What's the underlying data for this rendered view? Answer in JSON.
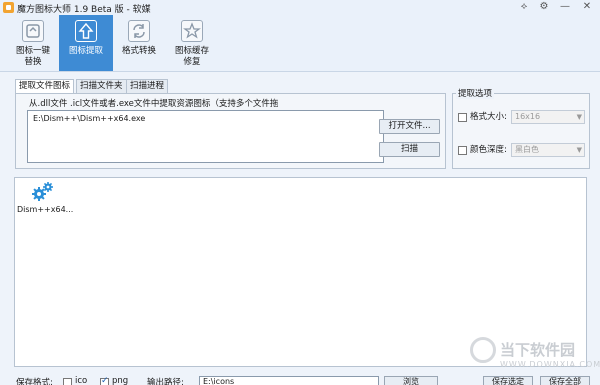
{
  "window": {
    "title": "魔方图标大师 1.9 Beta 版 - 软媒",
    "controls": {
      "skin": "⟡",
      "settings": "⚙",
      "minimize": "—",
      "close": "✕"
    }
  },
  "toolbar": {
    "items": [
      {
        "label": "图标一键\n替换",
        "icon": "replace-icon",
        "active": false
      },
      {
        "label": "图标提取",
        "icon": "extract-arrow-icon",
        "active": true
      },
      {
        "label": "格式转换",
        "icon": "convert-icon",
        "active": false
      },
      {
        "label": "图标缓存\n修复",
        "icon": "cache-repair-icon",
        "active": false
      }
    ]
  },
  "tabs": [
    {
      "label": "提取文件图标",
      "active": true
    },
    {
      "label": "扫描文件夹",
      "active": false
    },
    {
      "label": "扫描进程",
      "active": false
    }
  ],
  "extract": {
    "hint": "从.dll文件 .icl文件或者.exe文件中提取资源图标（支持多个文件拖",
    "path_value": "E:\\Dism++\\Dism++x64.exe",
    "open_button": "打开文件...",
    "scan_button": "扫描"
  },
  "options": {
    "title": "提取选项",
    "size_label": "格式大小:",
    "size_value": "16x16",
    "depth_label": "颜色深度:",
    "depth_value": "黑白色"
  },
  "results": {
    "items": [
      {
        "label": "Dism++x64...",
        "icon": "gears-icon"
      }
    ]
  },
  "watermark": {
    "main": "当下软件园",
    "sub": "WWW.DOWNXIA.COM"
  },
  "bottom": {
    "format_label": "保存格式:",
    "ico_label": "ico",
    "png_label": "png",
    "png_checked": true,
    "output_label": "输出路径:",
    "output_value": "E:\\icons",
    "browse_button": "浏览",
    "save_selected_button": "保存选定",
    "save_all_button": "保存全部"
  },
  "colors": {
    "accent": "#3e8bd4",
    "gear": "#2a8fd8"
  }
}
